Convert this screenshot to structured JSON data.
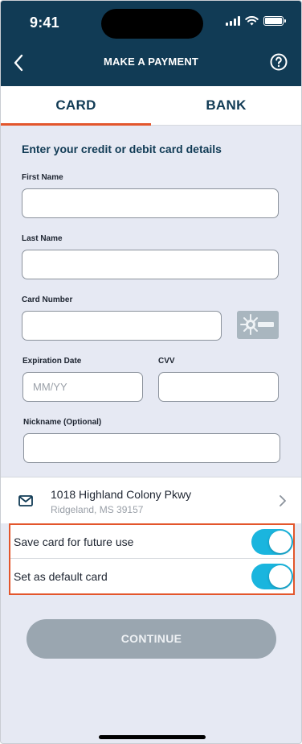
{
  "status_bar": {
    "time": "9:41",
    "icons": [
      "cellular-signal-icon",
      "wifi-icon",
      "battery-icon"
    ]
  },
  "header": {
    "title": "MAKE A PAYMENT",
    "back_icon": "chevron-left-icon",
    "help_icon": "question-circle-icon"
  },
  "tabs": [
    {
      "label": "CARD",
      "active": true
    },
    {
      "label": "BANK",
      "active": false
    }
  ],
  "form": {
    "heading": "Enter your credit or debit card details",
    "first_name": {
      "label": "First Name",
      "value": "",
      "placeholder": ""
    },
    "last_name": {
      "label": "Last Name",
      "value": "",
      "placeholder": ""
    },
    "card_number": {
      "label": "Card Number",
      "value": "",
      "placeholder": "",
      "scan_icon": "card-scan-icon"
    },
    "expiration": {
      "label": "Expiration Date",
      "value": "",
      "placeholder": "MM/YY"
    },
    "cvv": {
      "label": "CVV",
      "value": "",
      "placeholder": ""
    },
    "nickname": {
      "label": "Nickname (Optional)",
      "value": "",
      "placeholder": ""
    }
  },
  "address": {
    "icon": "mail-icon",
    "line1": "1018 Highland Colony Pkwy",
    "line2": "Ridgeland, MS 39157"
  },
  "toggles": [
    {
      "label": "Save card for future use",
      "on": true
    },
    {
      "label": "Set as default card",
      "on": true
    }
  ],
  "continue_label": "CONTINUE",
  "colors": {
    "header_bg": "#113b55",
    "accent": "#e3562c",
    "toggle_on": "#1ab5de",
    "button_disabled": "#9aa6b0",
    "page_bg": "#e6e9f3"
  }
}
